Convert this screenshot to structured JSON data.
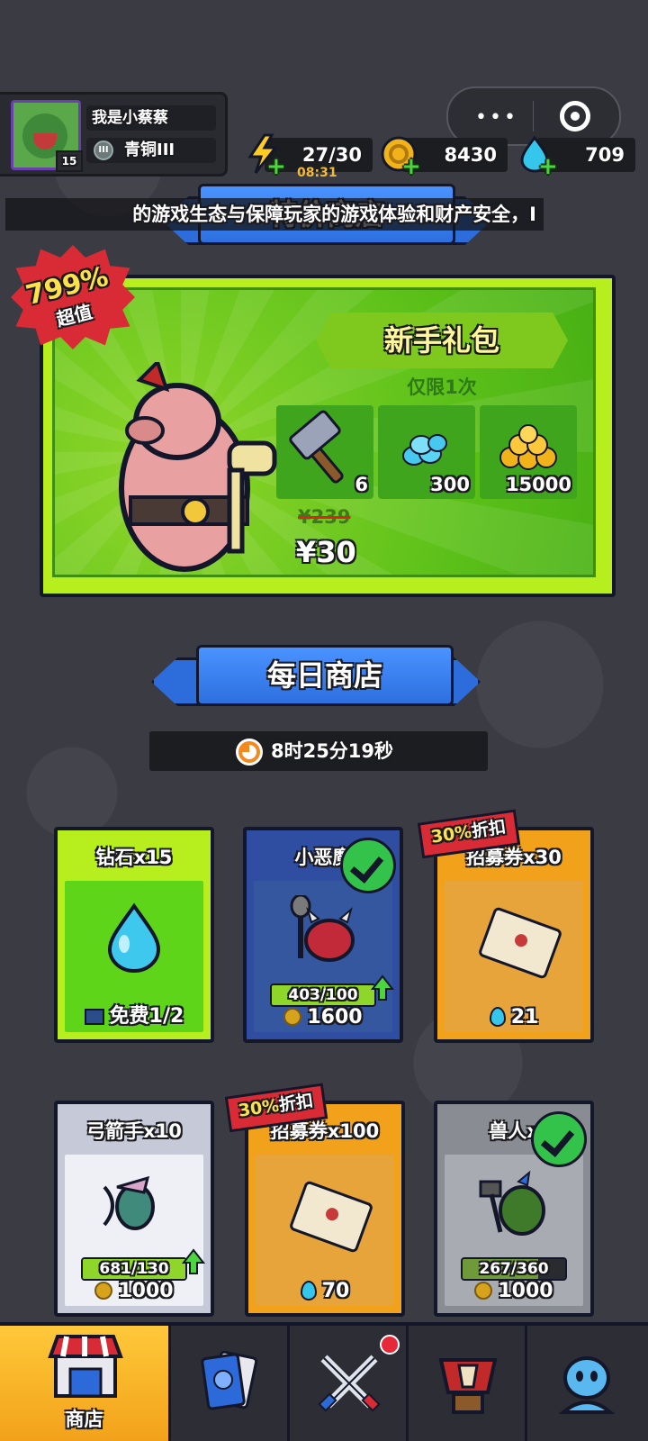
{
  "player": {
    "name": "我是小蔡蔡",
    "level": "15",
    "rank": "青铜III",
    "rank_icon": "shield-icon"
  },
  "mini_program": {
    "more_icon": "•••",
    "close_icon": "target-icon"
  },
  "resources": {
    "energy": {
      "value": "27/30",
      "timer": "08:31",
      "icon": "lightning-icon"
    },
    "gold": {
      "value": "8430",
      "icon": "coin-icon"
    },
    "gems": {
      "value": "709",
      "icon": "gem-icon"
    }
  },
  "marquee": "的游戏生态与保障玩家的游戏体验和财产安全，I",
  "special_shop": {
    "title": "特价商店"
  },
  "starter_pack": {
    "badge_percent": "799%",
    "badge_text": "超值",
    "title": "新手礼包",
    "limit": "仅限1次",
    "items": [
      {
        "icon": "hammer-icon",
        "qty": "6"
      },
      {
        "icon": "gems-pile-icon",
        "qty": "300"
      },
      {
        "icon": "gold-pile-icon",
        "qty": "15000"
      }
    ],
    "original_price": "¥239",
    "price": "¥30"
  },
  "daily_shop": {
    "title": "每日商店",
    "refresh_timer": "8时25分19秒",
    "cards": [
      {
        "title": "钻石x15",
        "price": "免费1/2",
        "price_icon": "video-icon",
        "theme": "green"
      },
      {
        "title": "小恶魔",
        "progress": "403/100",
        "progress_fraction": 1.0,
        "price": "1600",
        "price_icon": "coin-icon",
        "theme": "blue",
        "owned": true
      },
      {
        "title": "招募券x30",
        "discount_pct": "30%",
        "discount_word": "折扣",
        "price": "21",
        "price_icon": "gem-icon",
        "theme": "orange"
      },
      {
        "title": "弓箭手x10",
        "progress": "681/130",
        "progress_fraction": 1.0,
        "price": "1000",
        "price_icon": "coin-icon",
        "theme": "gray"
      },
      {
        "title": "招募券x100",
        "discount_pct": "30%",
        "discount_word": "折扣",
        "price": "70",
        "price_icon": "gem-icon",
        "theme": "orange"
      },
      {
        "title": "兽人x",
        "progress": "267/360",
        "progress_fraction": 0.74,
        "price": "1000",
        "price_icon": "coin-icon",
        "theme": "darkgray",
        "owned": true
      }
    ]
  },
  "nav": [
    {
      "label": "商店",
      "icon": "shop-icon",
      "active": true
    },
    {
      "label": "",
      "icon": "cards-icon"
    },
    {
      "label": "",
      "icon": "battle-swords-icon",
      "badge": true
    },
    {
      "label": "",
      "icon": "trophy-icon"
    },
    {
      "label": "",
      "icon": "social-icon"
    }
  ],
  "colors": {
    "accent_green": "#b7ef1e",
    "ribbon_blue": "#2d6fdf",
    "orange": "#f2a21a",
    "discount_red": "#d82b35"
  }
}
